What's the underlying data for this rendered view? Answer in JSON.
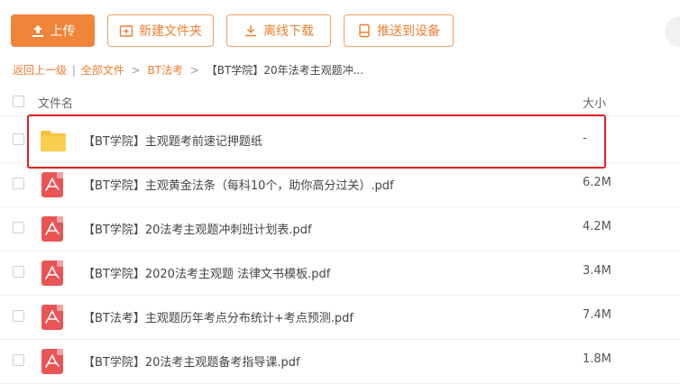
{
  "toolbar": {
    "upload_label": "上传",
    "new_folder_label": "新建文件夹",
    "offline_download_label": "离线下载",
    "push_device_label": "推送到设备"
  },
  "breadcrumb": {
    "back": "返回上一级",
    "divider": "|",
    "all_files": "全部文件",
    "arrow1": ">",
    "level1": "BT法考",
    "arrow2": ">",
    "current": "【BT学院】20年法考主观题冲..."
  },
  "table": {
    "col_name": "文件名",
    "col_size": "大小",
    "rows": [
      {
        "icon": "folder-icon",
        "name": "【BT学院】主观题考前速记押题纸",
        "size": "-"
      },
      {
        "icon": "pdf-icon",
        "name": "【BT学院】主观黄金法条（每科10个，助你高分过关）.pdf",
        "size": "6.2M"
      },
      {
        "icon": "pdf-icon",
        "name": "【BT学院】20法考主观题冲刺班计划表.pdf",
        "size": "4.2M"
      },
      {
        "icon": "pdf-icon",
        "name": "【BT学院】2020法考主观题 法律文书模板.pdf",
        "size": "3.4M"
      },
      {
        "icon": "pdf-icon",
        "name": "【BT法考】主观题历年考点分布统计+考点预测.pdf",
        "size": "7.4M"
      },
      {
        "icon": "pdf-icon",
        "name": "【BT学院】20法考主观题备考指导课.pdf",
        "size": "1.8M"
      }
    ]
  },
  "colors": {
    "accent": "#f08438",
    "pdf": "#ea5455",
    "folder": "#f7c23c",
    "highlight": "#e02020"
  }
}
